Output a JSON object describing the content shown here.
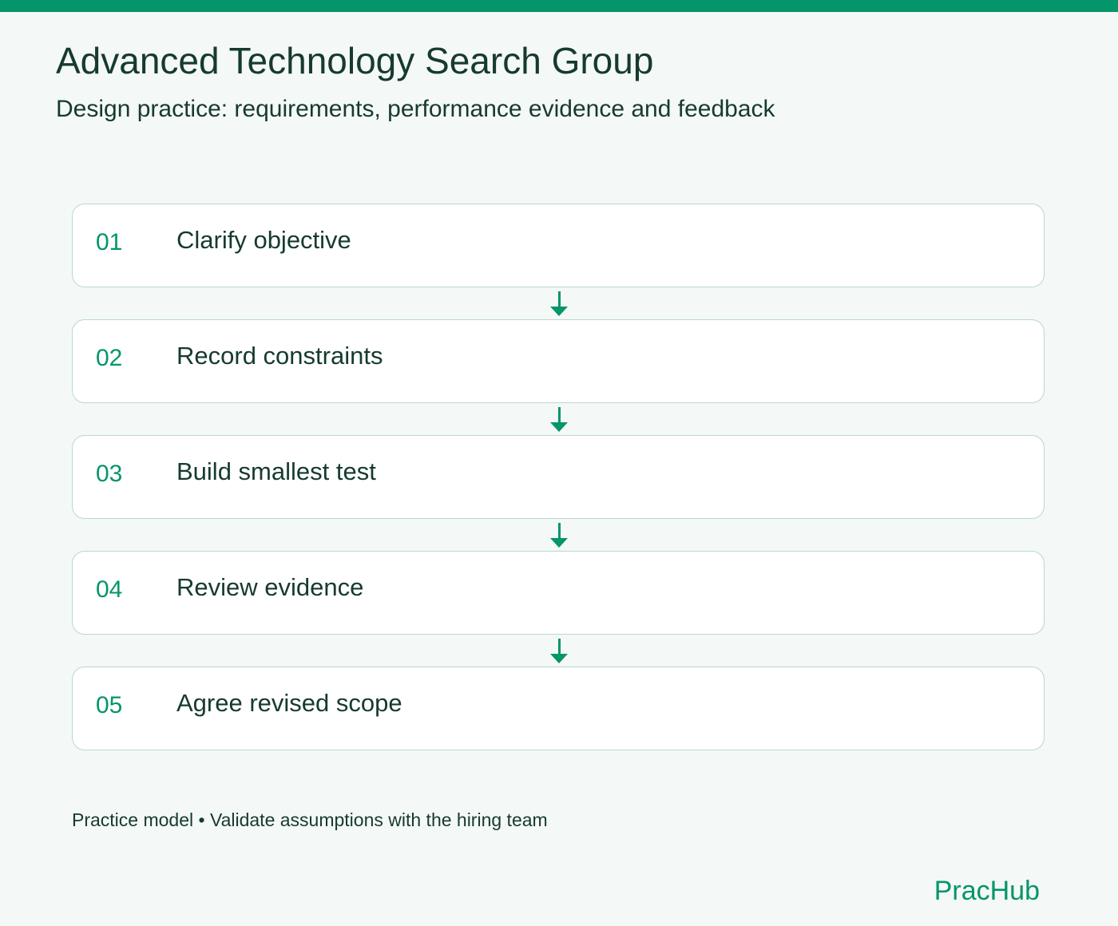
{
  "header": {
    "title": "Advanced Technology Search Group",
    "subtitle": "Design practice: requirements, performance evidence and feedback"
  },
  "steps": [
    {
      "number": "01",
      "label": "Clarify objective"
    },
    {
      "number": "02",
      "label": "Record constraints"
    },
    {
      "number": "03",
      "label": "Build smallest test"
    },
    {
      "number": "04",
      "label": "Review evidence"
    },
    {
      "number": "05",
      "label": "Agree revised scope"
    }
  ],
  "footer": {
    "note": "Practice model • Validate assumptions with the hiring team",
    "brand": "PracHub"
  },
  "colors": {
    "accent": "#04956a",
    "text": "#163a30",
    "background": "#f4f8f6",
    "card_border": "#b9d9cd"
  }
}
